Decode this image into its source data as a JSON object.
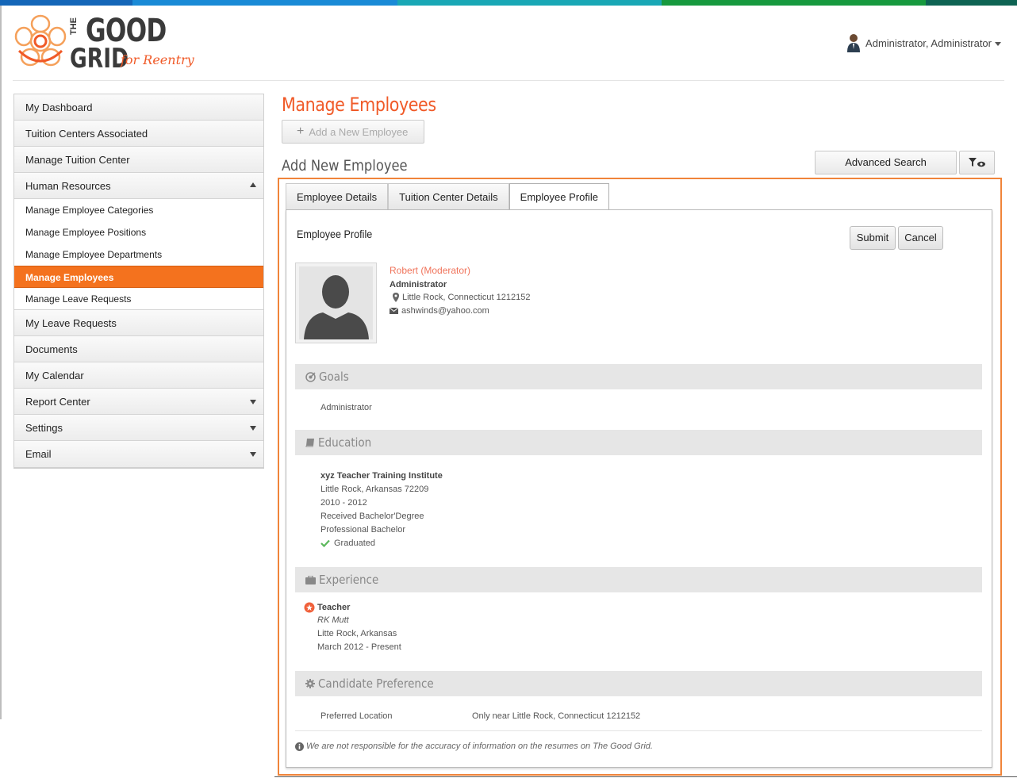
{
  "colors": {
    "accent": "#f05a28",
    "active_nav": "#f4721e",
    "topbar": [
      "#1572c8",
      "#1a8fd6",
      "#18a9b8",
      "#1aa04a",
      "#0e6a55"
    ]
  },
  "header": {
    "logo": {
      "the": "THE",
      "good": "GOOD",
      "grid": "GRID",
      "tagline": "for Reentry"
    },
    "user": {
      "name": "Administrator, Administrator",
      "icon": "user-avatar-icon"
    }
  },
  "sidebar": {
    "items": [
      {
        "label": "My Dashboard"
      },
      {
        "label": "Tuition Centers Associated"
      },
      {
        "label": "Manage Tuition Center"
      },
      {
        "label": "Human Resources",
        "expanded": true
      },
      {
        "label": "My Leave Requests"
      },
      {
        "label": "Documents"
      },
      {
        "label": "My Calendar"
      },
      {
        "label": "Report Center",
        "collapsible": true
      },
      {
        "label": "Settings",
        "collapsible": true
      },
      {
        "label": "Email",
        "collapsible": true
      }
    ],
    "sub_items": [
      {
        "label": "Manage Employee Categories"
      },
      {
        "label": "Manage Employee Positions"
      },
      {
        "label": "Manage Employee Departments"
      },
      {
        "label": "Manage Employees",
        "active": true
      },
      {
        "label": "Manage Leave Requests"
      }
    ]
  },
  "main": {
    "title": "Manage Employees",
    "add_button": "Add a New Employee",
    "section_title": "Add New Employee",
    "advanced_search": "Advanced Search",
    "tabs": [
      {
        "label": "Employee Details"
      },
      {
        "label": "Tuition Center Details"
      },
      {
        "label": "Employee Profile",
        "active": true
      }
    ],
    "panel": {
      "title": "Employee Profile",
      "submit": "Submit",
      "cancel": "Cancel",
      "profile": {
        "name": "Robert (Moderator)",
        "role": "Administrator",
        "location": "Little Rock, Connecticut  1212152",
        "email": "ashwinds@yahoo.com"
      },
      "goals": {
        "heading": "Goals",
        "text": "Administrator"
      },
      "education": {
        "heading": "Education",
        "institute": "xyz Teacher Training Institute",
        "location": "Little Rock, Arkansas  72209",
        "years": "2010 - 2012",
        "degree": "Received Bachelor'Degree",
        "level": "Professional Bachelor",
        "status": "Graduated"
      },
      "experience": {
        "heading": "Experience",
        "title": "Teacher",
        "company": "RK Mutt",
        "location": "Litte Rock, Arkansas",
        "period": "March 2012 - Present"
      },
      "preference": {
        "heading": "Candidate Preference",
        "label": "Preferred Location",
        "value": "Only near Little Rock, Connecticut 1212152"
      },
      "disclaimer": "We are not responsible for the accuracy of information on the resumes on The Good Grid."
    }
  }
}
